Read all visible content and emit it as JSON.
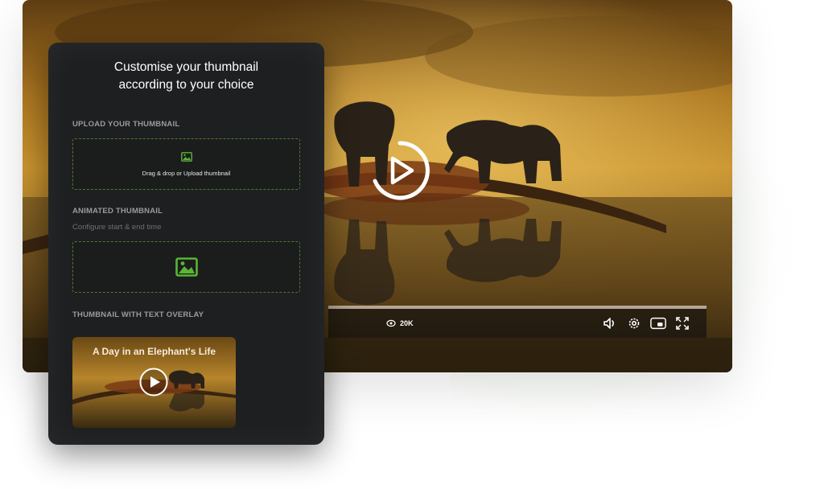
{
  "player": {
    "views_count": "20K",
    "icons": [
      "play-icon",
      "eye-icon",
      "volume-icon",
      "settings-icon",
      "pip-icon",
      "fullscreen-icon"
    ],
    "progress": 1.0
  },
  "panel": {
    "title": "Customise your thumbnail\naccording to your choice",
    "upload": {
      "label": "UPLOAD YOUR THUMBNAIL",
      "dropzone_text": "Drag & drop or Upload thumbnail"
    },
    "animated": {
      "label": "ANIMATED THUMBNAIL",
      "subtitle": "Configure start & end time"
    },
    "overlay": {
      "label": "THUMBNAIL WITH TEXT OVERLAY",
      "thumbnail_title": "A Day in an Elephant's Life"
    }
  },
  "colors": {
    "accent_green": "#5bb435",
    "panel_bg": "#1e1f21",
    "dashed_border": "#4d7a2e"
  }
}
